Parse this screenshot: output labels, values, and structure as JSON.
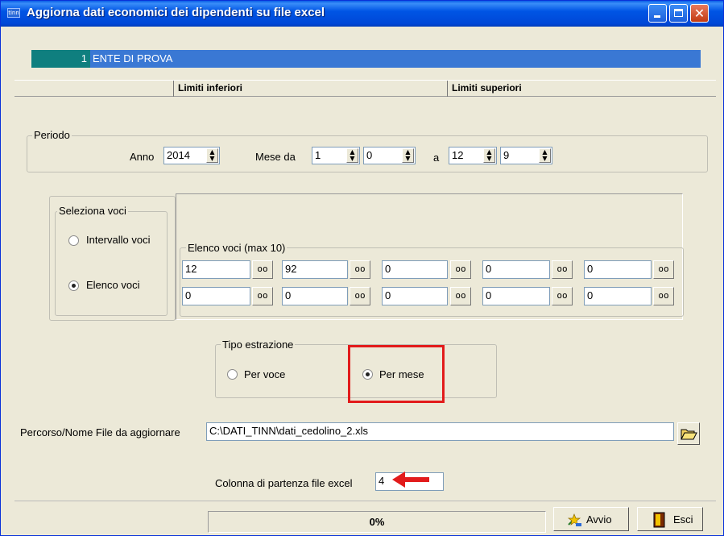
{
  "window": {
    "icon_text": "tinn",
    "title": "Aggiorna dati economici dei dipendenti su file excel",
    "controls": [
      "minimize-icon",
      "maximize-icon",
      "close-icon"
    ]
  },
  "ente": {
    "code": "1",
    "name": "ENTE DI PROVA"
  },
  "limits": {
    "inferiori": "Limiti inferiori",
    "superiori": "Limiti superiori"
  },
  "periodo": {
    "legend": "Periodo",
    "anno_label": "Anno",
    "anno": "2014",
    "mese_da_label": "Mese da",
    "mese_da": "1",
    "mese_da_2": "0",
    "a_label": "a",
    "mese_a": "12",
    "mese_a_2": "9"
  },
  "seleziona_voci": {
    "legend": "Seleziona voci",
    "intervallo": "Intervallo voci",
    "elenco": "Elenco voci",
    "selected": "elenco"
  },
  "elenco_voci": {
    "legend": "Elenco voci (max 10)",
    "row1": [
      "12",
      "92",
      "0",
      "0",
      "0"
    ],
    "row2": [
      "0",
      "0",
      "0",
      "0",
      "0"
    ]
  },
  "tipo_estrazione": {
    "legend": "Tipo estrazione",
    "per_voce": "Per voce",
    "per_mese": "Per mese",
    "selected": "per_mese"
  },
  "file": {
    "label": "Percorso/Nome File da aggiornare",
    "path": "C:\\DATI_TINN\\dati_cedolino_2.xls"
  },
  "colonna": {
    "label": "Colonna di partenza file excel",
    "value": "4"
  },
  "progress": {
    "text": "0%"
  },
  "buttons": {
    "avvio": "Avvio",
    "esci": "Esci"
  },
  "colors": {
    "title_blue": "#0055e5",
    "highlight_red": "#e21b1b",
    "ente_teal": "#0f7f7f",
    "ente_blue": "#3a78d4"
  }
}
